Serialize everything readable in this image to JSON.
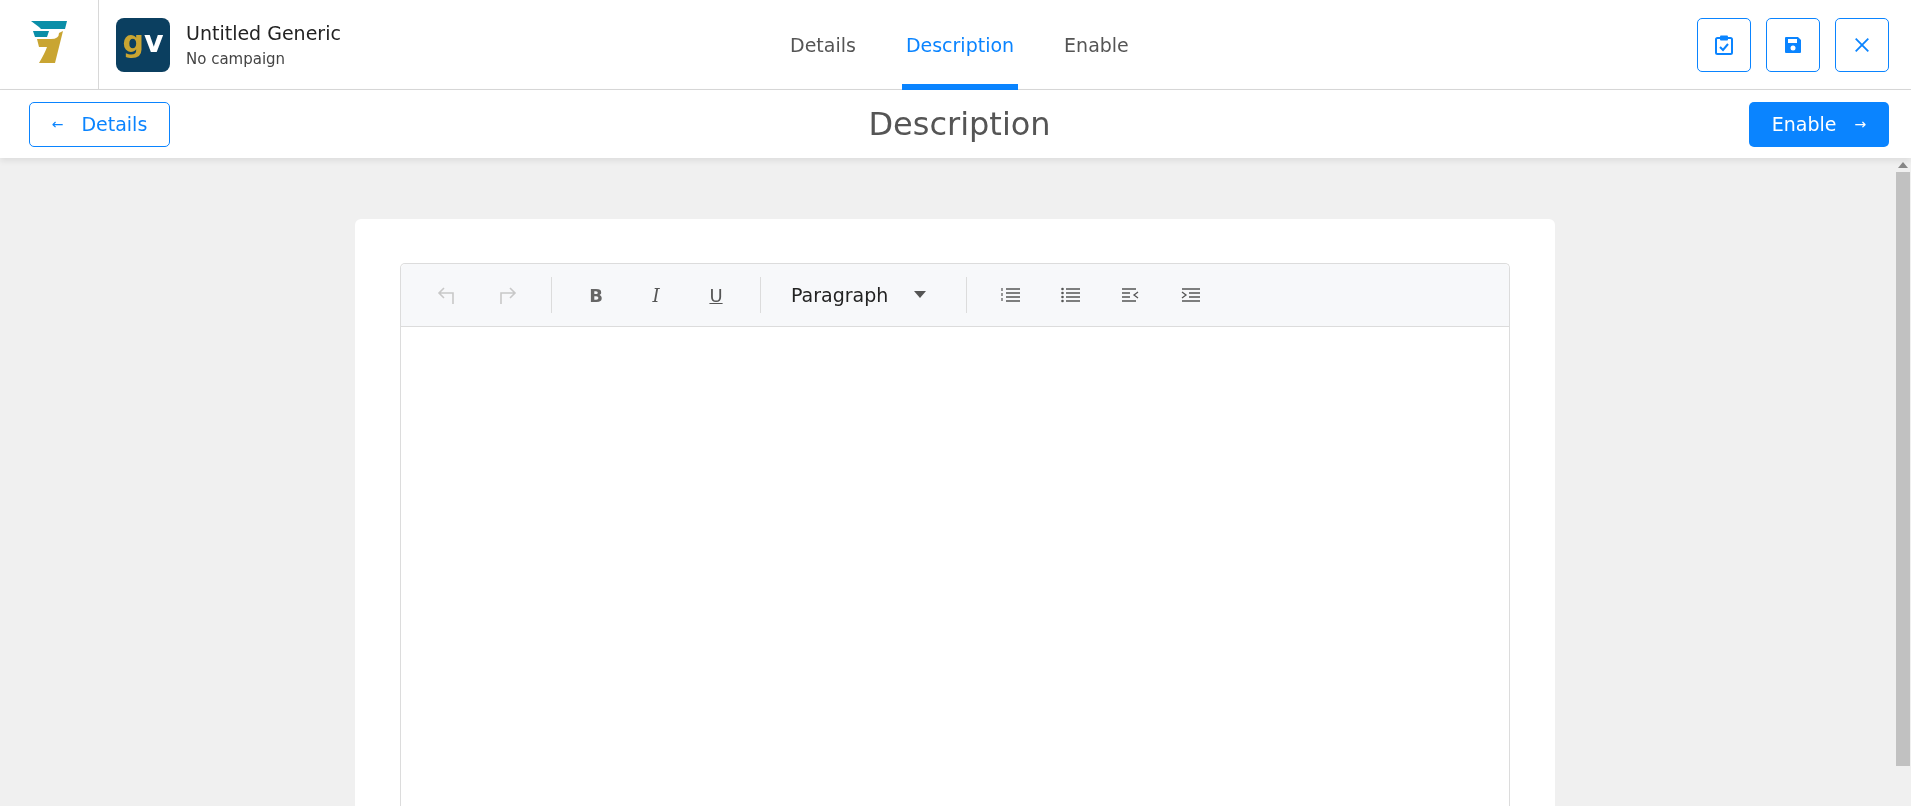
{
  "header": {
    "app_icon": {
      "letters": [
        "g",
        "v"
      ]
    },
    "title": "Untitled Generic",
    "subtitle": "No campaign"
  },
  "tabs": [
    {
      "label": "Details",
      "selected": false
    },
    {
      "label": "Description",
      "selected": true
    },
    {
      "label": "Enable",
      "selected": false
    }
  ],
  "header_actions": [
    {
      "kind": "checklist"
    },
    {
      "kind": "save"
    },
    {
      "kind": "close"
    }
  ],
  "subheader": {
    "back_button": {
      "arrow": "←",
      "label": "Details"
    },
    "title": "Description",
    "next_button": {
      "label": "Enable",
      "arrow": "→"
    }
  },
  "editor": {
    "toolbar": [
      {
        "kind": "undo",
        "disabled": true
      },
      {
        "kind": "redo",
        "disabled": true
      },
      {
        "kind": "divider"
      },
      {
        "kind": "bold",
        "label": "B",
        "disabled": false
      },
      {
        "kind": "italic",
        "label": "I",
        "disabled": false
      },
      {
        "kind": "underline",
        "label": "U",
        "disabled": false
      },
      {
        "kind": "divider"
      },
      {
        "kind": "block-format",
        "label": "Paragraph",
        "disabled": false
      },
      {
        "kind": "divider"
      },
      {
        "kind": "ordered-list",
        "disabled": false
      },
      {
        "kind": "bullet-list",
        "disabled": false
      },
      {
        "kind": "outdent",
        "disabled": false
      },
      {
        "kind": "indent",
        "disabled": false
      }
    ]
  }
}
